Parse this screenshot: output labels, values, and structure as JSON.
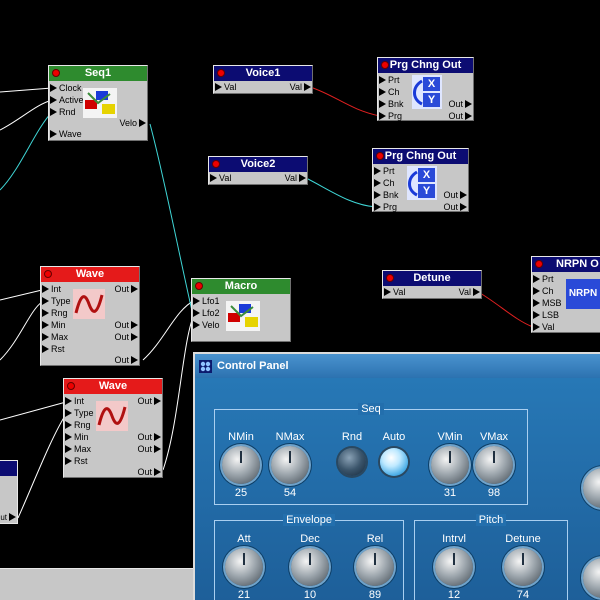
{
  "modules": {
    "seq1": {
      "title": "Seq1",
      "inputs": [
        "Clock",
        "Active",
        "Rnd",
        "Wave"
      ],
      "outputs": [
        "Velo"
      ]
    },
    "wave1": {
      "title": "Wave",
      "inputs": [
        "Int",
        "Type",
        "Rng",
        "Min",
        "Max",
        "Rst"
      ],
      "outputs": [
        "Out",
        "Out",
        "Out",
        "Out"
      ]
    },
    "wave2": {
      "title": "Wave",
      "inputs": [
        "Int",
        "Type",
        "Rng",
        "Min",
        "Max",
        "Rst"
      ],
      "outputs": [
        "Out",
        "Out",
        "Out",
        "Out"
      ]
    },
    "macro": {
      "title": "Macro",
      "inputs": [
        "Lfo1",
        "Lfo2",
        "Velo"
      ]
    },
    "voice1": {
      "title": "Voice1",
      "input": "Val",
      "output": "Val"
    },
    "voice2": {
      "title": "Voice2",
      "input": "Val",
      "output": "Val"
    },
    "detune": {
      "title": "Detune",
      "input": "Val",
      "output": "Val"
    },
    "prg1": {
      "title": "Prg Chng Out",
      "inputs": [
        "Prt",
        "Ch",
        "Bnk",
        "Prg"
      ],
      "outputs": [
        "Out",
        "Out"
      ],
      "icon_text": [
        "X",
        "Y"
      ]
    },
    "prg2": {
      "title": "Prg Chng Out",
      "inputs": [
        "Prt",
        "Ch",
        "Bnk",
        "Prg"
      ],
      "outputs": [
        "Out",
        "Out"
      ],
      "icon_text": [
        "X",
        "Y"
      ]
    },
    "nrpn": {
      "title": "NRPN O",
      "inputs": [
        "Prt",
        "Ch",
        "MSB",
        "LSB",
        "Val"
      ],
      "icon_text": "NRPN"
    },
    "partial_left": {
      "port": "ut"
    }
  },
  "control_panel": {
    "title": "Control Panel",
    "groups": {
      "seq": {
        "title": "Seq",
        "knobs": [
          {
            "label": "NMin",
            "value": "25"
          },
          {
            "label": "NMax",
            "value": "54"
          },
          {
            "label": "VMin",
            "value": "31"
          },
          {
            "label": "VMax",
            "value": "98"
          }
        ],
        "buttons": [
          {
            "label": "Rnd",
            "state": "off"
          },
          {
            "label": "Auto",
            "state": "on"
          }
        ]
      },
      "envelope": {
        "title": "Envelope",
        "knobs": [
          {
            "label": "Att",
            "value": "21"
          },
          {
            "label": "Dec",
            "value": "10"
          },
          {
            "label": "Rel",
            "value": "89"
          }
        ]
      },
      "pitch": {
        "title": "Pitch",
        "knobs": [
          {
            "label": "Intrvl",
            "value": "12"
          },
          {
            "label": "Detune",
            "value": "74"
          }
        ]
      }
    }
  },
  "colors": {
    "green_title": "#2e8b2e",
    "red_title": "#e51a1a",
    "navy_title": "#0c0c72",
    "wire_white": "#ffffff",
    "wire_cyan": "#3fd6d6",
    "wire_red": "#e02020",
    "panel_blue": "#1f6aa6"
  }
}
